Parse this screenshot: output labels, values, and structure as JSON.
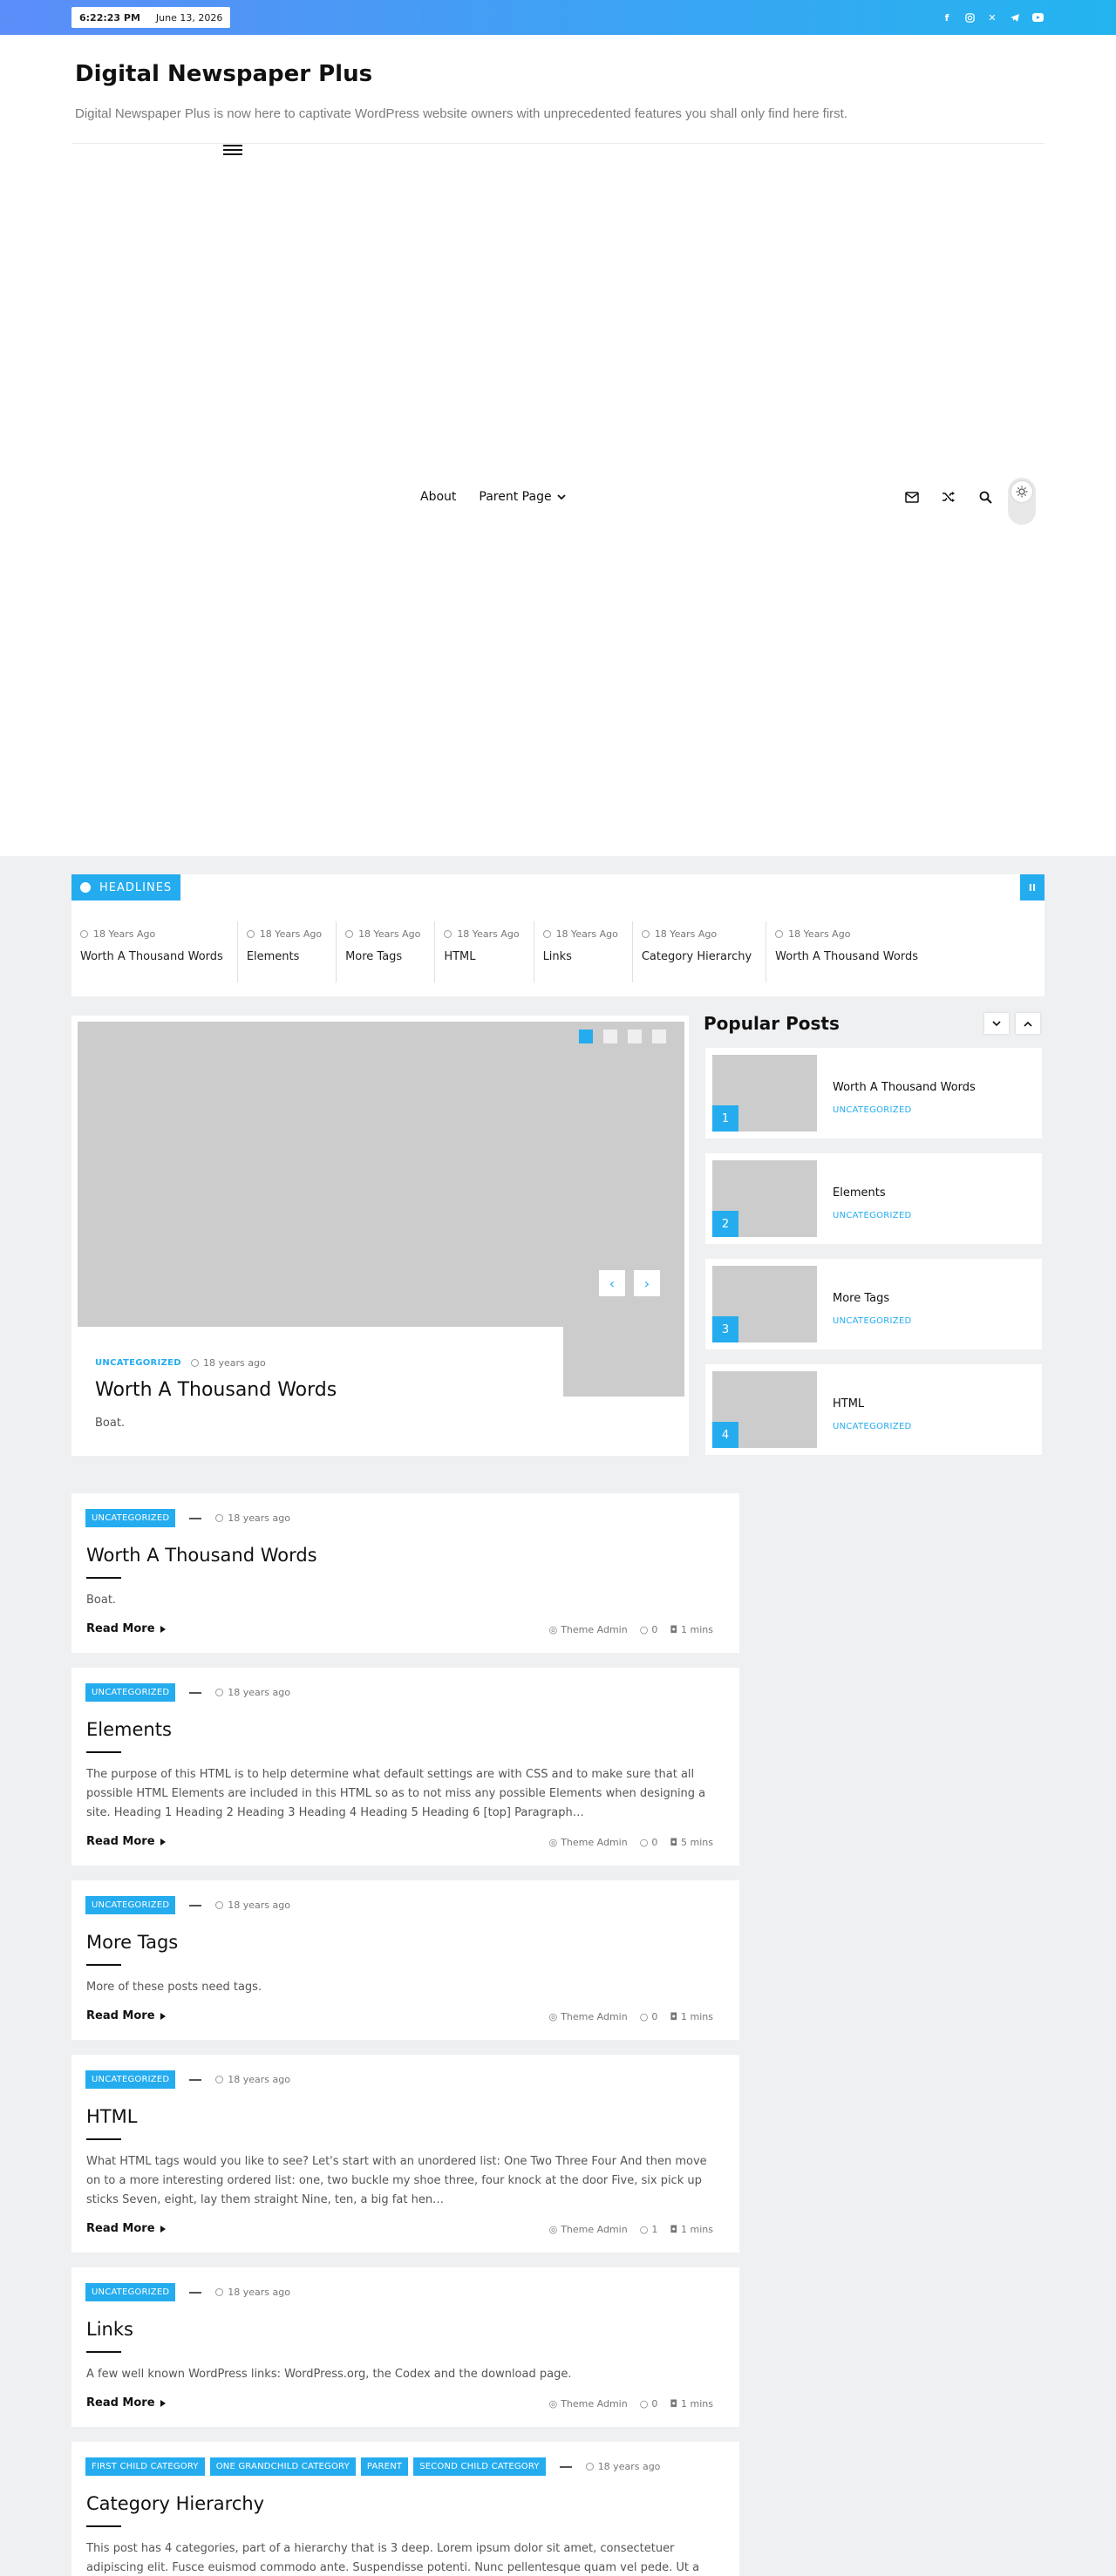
{
  "topbar": {
    "time": "6:22:23 PM",
    "date": "June 13, 2026",
    "social_icons": [
      "facebook-icon",
      "instagram-icon",
      "x-icon",
      "telegram-icon",
      "youtube-icon"
    ],
    "accent": "#24acef"
  },
  "header": {
    "site_title": "Digital Newspaper Plus",
    "tagline": "Digital Newspaper Plus is now here to captivate WordPress website owners with unprecedented features you shall only find here first."
  },
  "nav": {
    "items": [
      {
        "label": "About"
      },
      {
        "label": "Parent Page"
      }
    ]
  },
  "ticker": {
    "label": "HEADLINES",
    "items": [
      {
        "date": "18 Years Ago",
        "title": "Worth A Thousand Words"
      },
      {
        "date": "18 Years Ago",
        "title": "Elements"
      },
      {
        "date": "18 Years Ago",
        "title": "More Tags"
      },
      {
        "date": "18 Years Ago",
        "title": "HTML"
      },
      {
        "date": "18 Years Ago",
        "title": "Links"
      },
      {
        "date": "18 Years Ago",
        "title": "Category Hierarchy"
      },
      {
        "date": "18 Years Ago",
        "title": "Worth A Thousand Words"
      }
    ]
  },
  "slider": {
    "category": "UNCATEGORIZED",
    "date": "18 years ago",
    "title": "Worth A Thousand Words",
    "excerpt": "Boat."
  },
  "popular": {
    "heading": "Popular Posts",
    "items": [
      {
        "num": "1",
        "title": "Worth A Thousand Words",
        "category": "UNCATEGORIZED"
      },
      {
        "num": "2",
        "title": "Elements",
        "category": "UNCATEGORIZED"
      },
      {
        "num": "3",
        "title": "More Tags",
        "category": "UNCATEGORIZED"
      },
      {
        "num": "4",
        "title": "HTML",
        "category": "UNCATEGORIZED"
      }
    ]
  },
  "posts": [
    {
      "cats": [
        "UNCATEGORIZED"
      ],
      "date": "18 years ago",
      "title": "Worth A Thousand Words",
      "excerpt": "Boat.",
      "read_more": "Read More",
      "author": "Theme Admin",
      "comments": "0",
      "read_time": "1 mins"
    },
    {
      "cats": [
        "UNCATEGORIZED"
      ],
      "date": "18 years ago",
      "title": "Elements",
      "excerpt": "The purpose of this HTML is to help determine what default settings are with CSS and to make sure that all possible HTML Elements are included in this HTML so as to not miss any possible Elements when designing a site. Heading 1 Heading 2 Heading 3 Heading 4 Heading 5 Heading 6 [top] Paragraph…",
      "read_more": "Read More",
      "author": "Theme Admin",
      "comments": "0",
      "read_time": "5 mins"
    },
    {
      "cats": [
        "UNCATEGORIZED"
      ],
      "date": "18 years ago",
      "title": "More Tags",
      "excerpt": "More of these posts need tags.",
      "read_more": "Read More",
      "author": "Theme Admin",
      "comments": "0",
      "read_time": "1 mins"
    },
    {
      "cats": [
        "UNCATEGORIZED"
      ],
      "date": "18 years ago",
      "title": "HTML",
      "excerpt": "What HTML tags would you like to see? Let's start with an unordered list: One Two Three Four And then move on to a more interesting ordered list: one, two buckle my shoe three, four knock at the door Five, six pick up sticks Seven, eight, lay them straight Nine, ten, a big fat hen…",
      "read_more": "Read More",
      "author": "Theme Admin",
      "comments": "1",
      "read_time": "1 mins"
    },
    {
      "cats": [
        "UNCATEGORIZED"
      ],
      "date": "18 years ago",
      "title": "Links",
      "excerpt": "A few well known WordPress links: WordPress.org, the Codex and the download page.",
      "read_more": "Read More",
      "author": "Theme Admin",
      "comments": "0",
      "read_time": "1 mins"
    },
    {
      "cats": [
        "FIRST CHILD CATEGORY",
        "ONE GRANDCHILD CATEGORY",
        "PARENT",
        "SECOND CHILD CATEGORY"
      ],
      "date": "18 years ago",
      "title": "Category Hierarchy",
      "excerpt": "This post has 4 categories, part of a hierarchy that is 3 deep. Lorem ipsum dolor sit amet, consectetuer adipiscing elit. Fusce euismod commodo ante. Suspendisse potenti. Nunc pellentesque quam vel pede. Ut a",
      "read_more": "",
      "author": "",
      "comments": "",
      "read_time": ""
    }
  ]
}
